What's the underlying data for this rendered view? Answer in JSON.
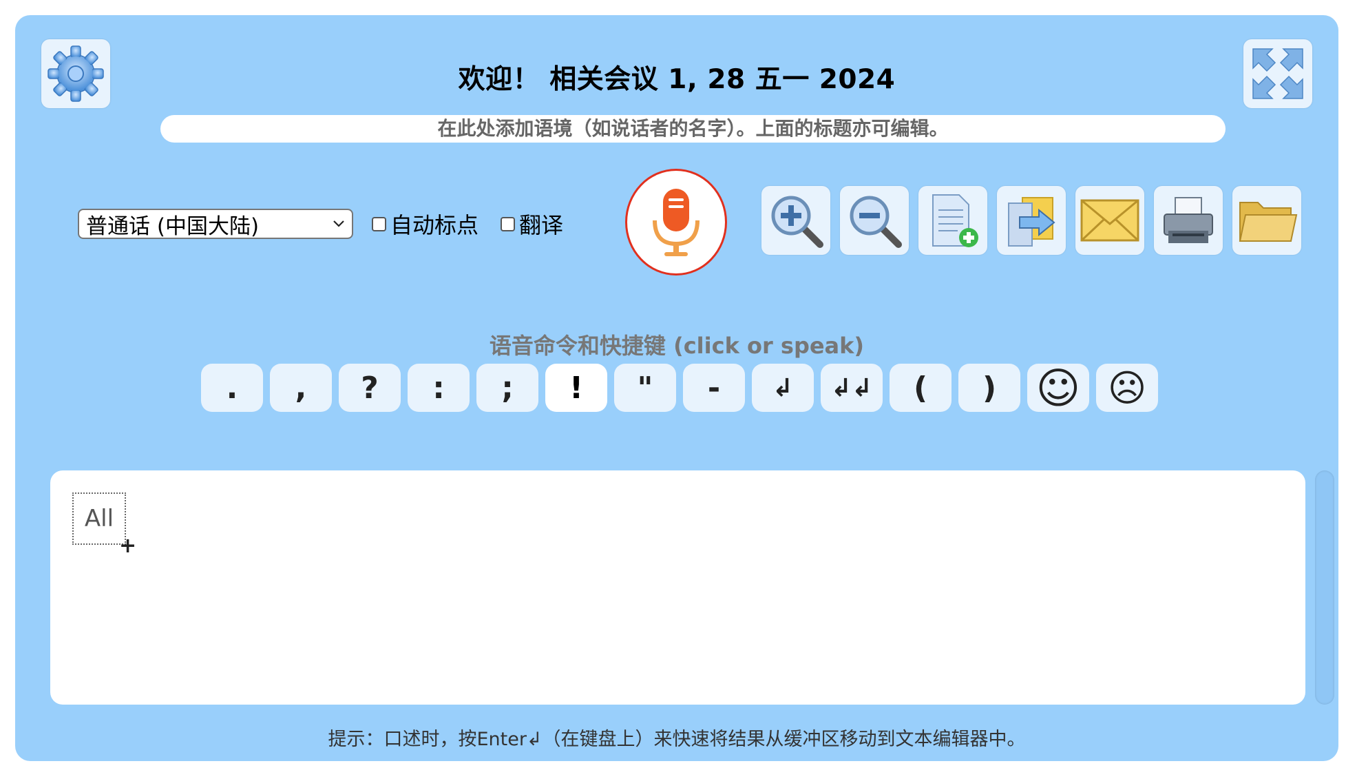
{
  "header": {
    "title": "欢迎！ 相关会议 1, 28 五一 2024",
    "context_placeholder": "在此处添加语境（如说话者的名字）。上面的标题亦可编辑。"
  },
  "icons": {
    "settings": "gear-icon",
    "fullscreen": "fullscreen-icon",
    "mic": "microphone-icon"
  },
  "controls": {
    "language": "普通话 (中国大陆)",
    "auto_punctuation_label": "自动标点",
    "translate_label": "翻译"
  },
  "toolbar": {
    "buttons": [
      {
        "name": "zoom-in",
        "icon": "zoom-in-icon"
      },
      {
        "name": "zoom-out",
        "icon": "zoom-out-icon"
      },
      {
        "name": "new-document",
        "icon": "new-document-icon"
      },
      {
        "name": "export",
        "icon": "export-icon"
      },
      {
        "name": "email",
        "icon": "envelope-icon"
      },
      {
        "name": "print",
        "icon": "printer-icon"
      },
      {
        "name": "open",
        "icon": "folder-icon"
      }
    ]
  },
  "commands": {
    "label": "语音命令和快捷键 (click or speak)",
    "keys": [
      ".",
      ",",
      "?",
      ":",
      ";",
      "!",
      "\"",
      "-",
      "↲",
      "↲↲",
      "(",
      ")",
      "☺",
      "☹"
    ]
  },
  "editor": {
    "select_all_label": "All",
    "cursor_glyph": "+"
  },
  "footer": {
    "hint": "提示：口述时，按Enter↲（在键盘上）来快速将结果从缓冲区移动到文本编辑器中。"
  },
  "colors": {
    "panel": "#99cffb",
    "button_bg": "#e8f3fd",
    "mic_ring": "#e1301e",
    "mic_body": "#ee5a24"
  }
}
